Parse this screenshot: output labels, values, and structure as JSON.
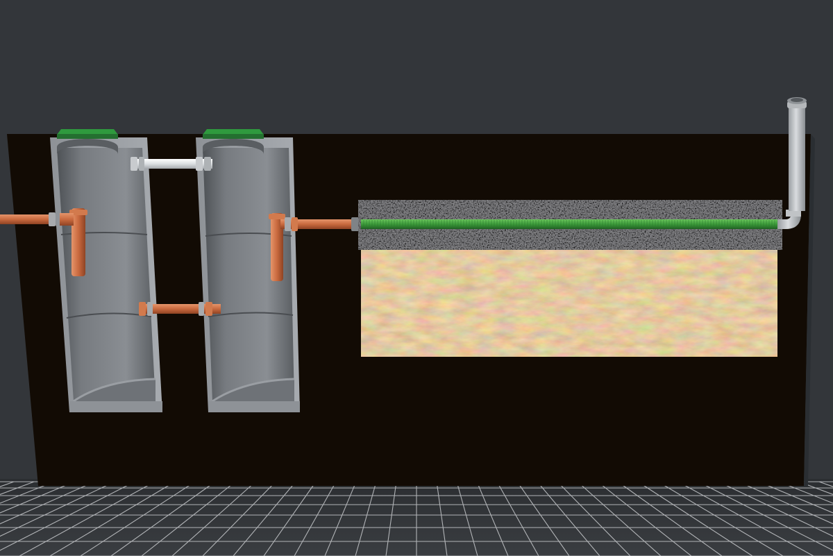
{
  "scene": {
    "kind": "septic-system-cross-section",
    "components": [
      {
        "id": "inlet-pipe",
        "material": "pvc",
        "color": "#c96a3f"
      },
      {
        "id": "tank-1",
        "kind": "concrete-ring-well",
        "lid_color": "#2f9a3e"
      },
      {
        "id": "tank-2",
        "kind": "concrete-ring-well",
        "lid_color": "#2f9a3e"
      },
      {
        "id": "overflow-pipe-top",
        "color": "#e6e8ea"
      },
      {
        "id": "overflow-pipe-bottom",
        "color": "#c96a3f"
      },
      {
        "id": "outlet-pipe",
        "color": "#c96a3f"
      },
      {
        "id": "drain-pipe",
        "kind": "perforated-drain",
        "color": "#3c9a3a"
      },
      {
        "id": "gravel-bed",
        "color": "#3a3a3c"
      },
      {
        "id": "sand-bed",
        "color": "#b88c57"
      },
      {
        "id": "vent-riser",
        "color": "#b9bcc0"
      }
    ]
  },
  "colors": {
    "background": "#33363a",
    "soil": "#120b04",
    "concrete": "#85898e",
    "pipe_orange": "#c96a3f",
    "grid_line": "#c9cbce"
  }
}
